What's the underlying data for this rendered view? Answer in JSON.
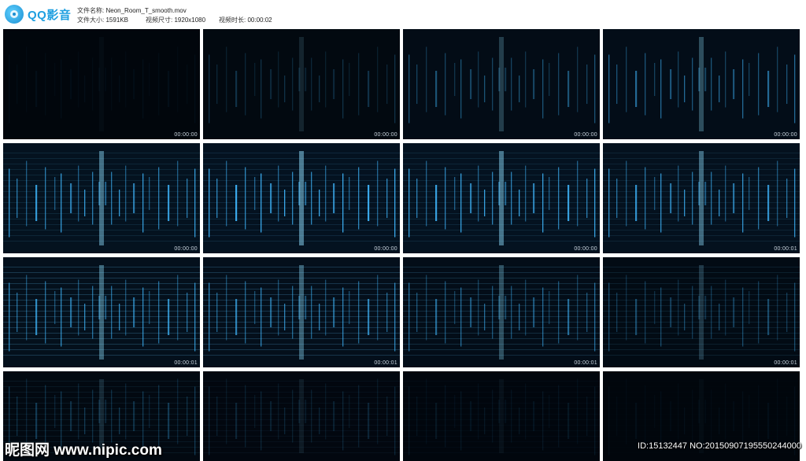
{
  "app": {
    "name": "QQ影音",
    "logo_icon": "qq-player-icon"
  },
  "file": {
    "name_label": "文件名称:",
    "name_value": "Neon_Room_T_smooth.mov",
    "size_label": "文件大小:",
    "size_value": "1591KB",
    "resolution_label": "视频尺寸:",
    "resolution_value": "1920x1080",
    "duration_label": "视频时长:",
    "duration_value": "00:00:02"
  },
  "accent_color": "#3fb8ff",
  "thumbnails": [
    {
      "timestamp": "00:00:00",
      "brightness": 0.06
    },
    {
      "timestamp": "00:00:00",
      "brightness": 0.25
    },
    {
      "timestamp": "00:00:00",
      "brightness": 0.45
    },
    {
      "timestamp": "00:00:00",
      "brightness": 0.6
    },
    {
      "timestamp": "00:00:00",
      "brightness": 0.9
    },
    {
      "timestamp": "00:00:00",
      "brightness": 1.0
    },
    {
      "timestamp": "00:00:00",
      "brightness": 0.95
    },
    {
      "timestamp": "00:00:01",
      "brightness": 0.85
    },
    {
      "timestamp": "00:00:01",
      "brightness": 0.8
    },
    {
      "timestamp": "00:00:01",
      "brightness": 0.75
    },
    {
      "timestamp": "00:00:01",
      "brightness": 0.6
    },
    {
      "timestamp": "00:00:01",
      "brightness": 0.4
    },
    {
      "timestamp": "",
      "brightness": 0.3
    },
    {
      "timestamp": "",
      "brightness": 0.18
    },
    {
      "timestamp": "",
      "brightness": 0.1
    },
    {
      "timestamp": "",
      "brightness": 0.05
    }
  ],
  "watermark": {
    "site": "昵图网 www.nipic.com",
    "id": "ID:15132447 NO:20150907195550244000"
  }
}
